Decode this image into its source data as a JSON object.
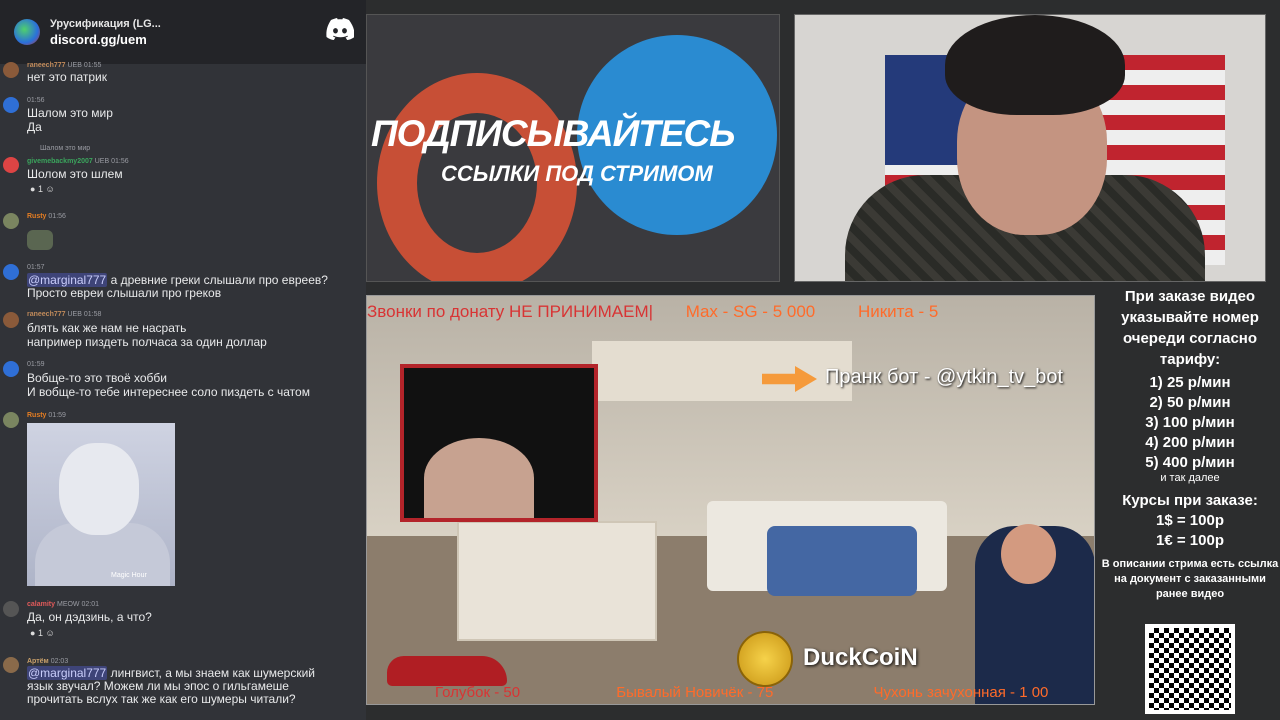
{
  "chat": {
    "server_name": "Урусификация (LG...",
    "invite_link": "discord.gg/uem",
    "messages": [
      {
        "author": "raneech777",
        "badges": "UEB",
        "time": "01:55",
        "text": "нет это патрик"
      },
      {
        "author": "",
        "time": "01:56",
        "text": "Шалом это мир",
        "text2": "Да"
      },
      {
        "reply_to": "Шалом это мир",
        "author": "givemebackmy2007",
        "badges": "UEB",
        "time": "01:56",
        "text": "Шолом это шлем",
        "reaction_count": "1"
      },
      {
        "author": "Rusty",
        "time": "01:56"
      },
      {
        "author": "",
        "time": "01:57",
        "mention": "@marginal777",
        "text": " а древние греки слышали про евреев?",
        "text2": "Просто евреи слышали про греков"
      },
      {
        "author": "raneech777",
        "badges": "UEB",
        "time": "01:58",
        "text": "блять как же нам не насрать",
        "text2": "например пиздеть полчаса за один доллар"
      },
      {
        "author": "",
        "time": "01:59",
        "text": "Вобще-то это твоё хобби",
        "text2": "И вобще-то тебе интереснее соло пиздеть с чатом"
      },
      {
        "author": "Rusty",
        "time": "01:59",
        "image_caption": "Magic Hour"
      },
      {
        "author": "calamity",
        "badges": "MEOW",
        "time": "02:01",
        "text": "Да, он дэдзинь, а что?",
        "reaction_count": "1"
      },
      {
        "author": "Артём",
        "time": "02:03",
        "mention": "@marginal777",
        "text": " лингвист, а мы знаем как шумерский",
        "text2": "язык звучал? Можем ли мы эпос о гильгамеше",
        "text3": "прочитать вслух так же как его шумеры читали?"
      }
    ]
  },
  "banner": {
    "title": "ПОДПИСЫВАЙТЕСЬ",
    "subtitle": "ССЫЛКИ ПОД СТРИМОМ"
  },
  "stream": {
    "ticker_text": "Звонки по донату НЕ ПРИНИМАЕМ|",
    "ticker_sponsor_1": "Max - SG - 5 000",
    "ticker_sponsor_2": "Никита - 5",
    "prank_label": "Пранк бот - @ytkin_tv_bot",
    "coin_label": "DuckCoiN",
    "bottom_1": "Голубок - 50",
    "bottom_2": "Бывалый Новичёк - 75",
    "bottom_3": "Чухонь зачухонная - 1 00"
  },
  "info": {
    "title": "При заказе видео указывайте номер очереди согласно тарифу:",
    "tariffs": [
      "1) 25 р/мин",
      "2) 50 р/мин",
      "3) 100 р/мин",
      "4) 200 р/мин",
      "5) 400 р/мин"
    ],
    "etc": "и так далее",
    "rates_title": "Курсы при заказе:",
    "rate_usd": "1$ = 100р",
    "rate_eur": "1€ = 100р",
    "note": "В описании стрима есть ссылка на документ с заказанными ранее видео"
  }
}
